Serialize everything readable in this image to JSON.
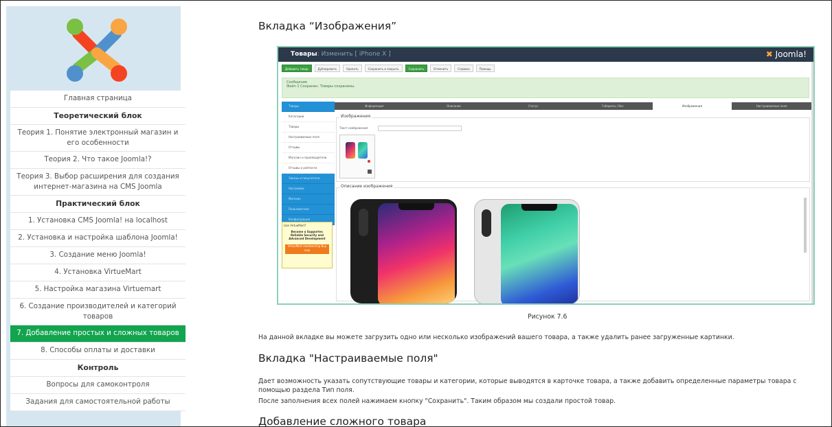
{
  "sidebar": {
    "items": [
      {
        "label": "Главная страница",
        "type": "link"
      },
      {
        "label": "Теоретический блок",
        "type": "header"
      },
      {
        "label": "Теория 1. Понятие электронный магазин и его особенности",
        "type": "link"
      },
      {
        "label": "Теория 2. Что такое Joomla!?",
        "type": "link"
      },
      {
        "label": "Теория 3. Выбор расширения для создания интернет-магазина на CMS Joomla",
        "type": "link"
      },
      {
        "label": "Практический блок",
        "type": "header"
      },
      {
        "label": "1. Установка CMS Joomla! на localhost",
        "type": "link"
      },
      {
        "label": "2. Установка и настройка шаблона Joomla!",
        "type": "link"
      },
      {
        "label": "3. Создание меню Joomla!",
        "type": "link"
      },
      {
        "label": "4. Установка VirtueMart",
        "type": "link"
      },
      {
        "label": "5. Настройка магазина Virtuemart",
        "type": "link"
      },
      {
        "label": "6. Создание производителей и категорий товаров",
        "type": "link"
      },
      {
        "label": "7. Добавление простых и сложных товаров",
        "type": "active"
      },
      {
        "label": "8. Способы оплаты и доставки",
        "type": "link"
      },
      {
        "label": "Контроль",
        "type": "header"
      },
      {
        "label": "Вопросы для самоконтроля",
        "type": "link"
      },
      {
        "label": "Задания для самостоятельной работы",
        "type": "link"
      }
    ],
    "active_color": "#12a44e"
  },
  "main": {
    "heading1": "Вкладка “Изображения”",
    "caption": "Рисунок 7.6",
    "para1": "На данной вкладке вы можете загрузить одно или несколько изображений вашего товара, а также удалить ранее загруженные картинки.",
    "heading2": "Вкладка \"Настраиваемые поля\"",
    "para2": "Дает возможность указать сопутствующие товары и категории, которые выводятся в карточке товара, а также добавить определенные параметры товара с помощью раздела Тип поля.",
    "para3": "После заполнения всех полей нажимаем кнопку \"Сохранить\". Таким образом мы создали простой товар.",
    "heading3": "Добавление сложного товара"
  },
  "screenshot": {
    "title_main": "Товары",
    "title_rest": ": Изменить [ iPhone X ]",
    "brand": "Joomla!",
    "toolbar": [
      "Добавить товар",
      "Дублировать",
      "Удалить",
      "Сохранить и закрыть",
      "Сохранить",
      "Отменить",
      "Справка",
      "Помощь"
    ],
    "message_title": "Сообщение",
    "message_text": "Файл 1 Сохранен. Товары сохранены.",
    "left_menu": [
      "Товары",
      "Категории",
      "Товары",
      "Настраиваемые поля",
      "Отзывы",
      "Магазин и производители",
      "Отзывы и рейтинги",
      "Заказы и покупатели",
      "Настройки",
      "Магазин",
      "Пользователи",
      "Конфигурация"
    ],
    "ad_title": "Like VirtueMart?",
    "ad_text": "Become a Supporter. Reliable Security and Advanced Development",
    "ad_button": "VirtueMart membership Buy now",
    "tabs": [
      "Информация",
      "Описание",
      "Статус",
      "Габариты / Вес",
      "Изображения",
      "Настраиваемые поля"
    ],
    "active_tab": 4,
    "legend1": "Изображения",
    "legend2": "Описание изображения",
    "upload_label": "Текст изображения"
  }
}
